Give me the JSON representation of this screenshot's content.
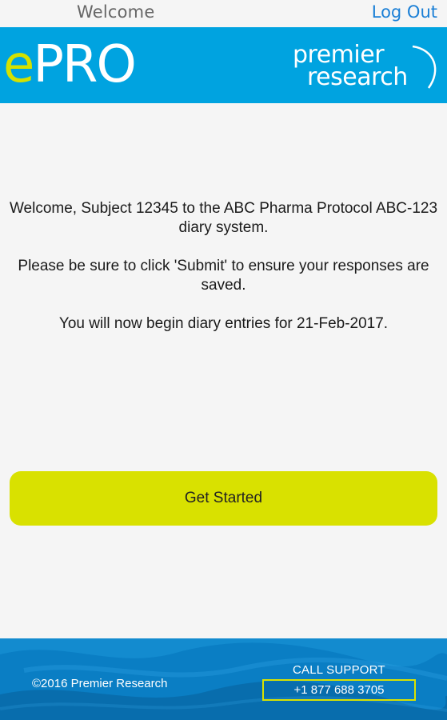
{
  "topbar": {
    "title": "Welcome",
    "logout_label": "Log Out"
  },
  "header": {
    "app_logo_e": "e",
    "app_logo_rest": "PRO",
    "brand_line1": "premier",
    "brand_line2": "research"
  },
  "message": {
    "line1": "Welcome, Subject 12345 to the ABC Pharma Protocol ABC-123 diary system.",
    "line2": "Please be sure to click 'Submit' to ensure your responses are saved.",
    "line3": "You will now begin diary entries for 21-Feb-2017."
  },
  "actions": {
    "get_started_label": "Get Started"
  },
  "footer": {
    "copyright": "©2016 Premier Research",
    "support_label": "CALL SUPPORT",
    "support_phone": "+1 877 688 3705"
  },
  "colors": {
    "header_blue": "#00a3e0",
    "accent_lime": "#d9e100",
    "link_blue": "#1a7fd6",
    "footer_blue": "#0a7ec4"
  }
}
